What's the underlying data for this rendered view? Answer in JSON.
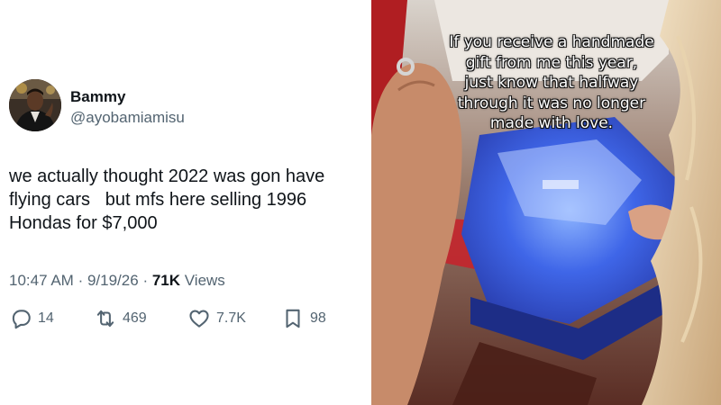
{
  "tweet": {
    "display_name": "Bammy",
    "handle": "@ayobamiamisu",
    "text_lines": [
      "we actually thought 2022 was gon have",
      "flying cars   but mfs here selling 1996",
      "Hondas for $7,000"
    ],
    "time": "10:47 AM",
    "date": "9/19/26",
    "views_count": "71K",
    "views_label": "Views",
    "separator": "·",
    "actions": {
      "replies": "14",
      "retweets": "469",
      "likes": "7.7K",
      "bookmarks": "98"
    }
  },
  "photo": {
    "caption_lines": [
      "If you receive a handmade",
      "gift from me this year,",
      "just know that halfway",
      "through it was no longer",
      "made with love."
    ]
  },
  "colors": {
    "text_primary": "#0f1419",
    "text_secondary": "#536471"
  }
}
